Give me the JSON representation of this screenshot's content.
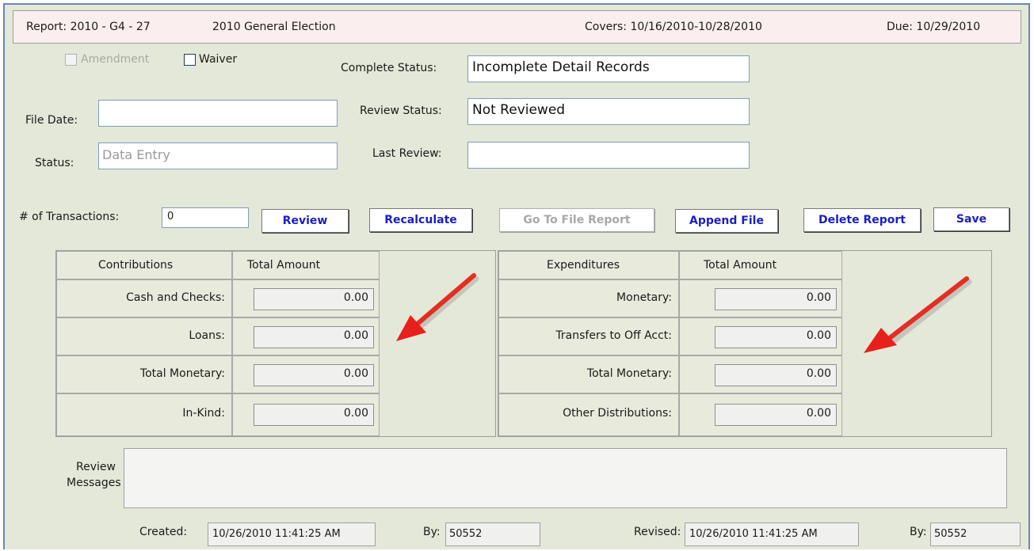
{
  "header": {
    "report": "Report: 2010 - G4 - 27",
    "election": "2010 General Election",
    "covers": "Covers:  10/16/2010-10/28/2010",
    "due": "Due:  10/29/2010"
  },
  "form": {
    "amendment_label": "Amendment",
    "waiver_label": "Waiver",
    "file_date_label": "File Date:",
    "file_date_value": "",
    "status_label": "Status:",
    "status_value": "Data Entry",
    "complete_status_label": "Complete Status:",
    "complete_status_value": "Incomplete Detail Records",
    "review_status_label": "Review Status:",
    "review_status_value": "Not Reviewed",
    "last_review_label": "Last Review:",
    "last_review_value": "",
    "transactions_label": "# of Transactions:",
    "transactions_value": "0"
  },
  "buttons": {
    "review": "Review",
    "recalculate": "Recalculate",
    "go_to_file": "Go To File Report",
    "append": "Append File",
    "delete": "Delete Report",
    "save": "Save"
  },
  "contributions": {
    "header": "Contributions",
    "amount_header": "Total Amount",
    "rows": [
      {
        "label": "Cash and Checks:",
        "value": "0.00"
      },
      {
        "label": "Loans:",
        "value": "0.00"
      },
      {
        "label": "Total Monetary:",
        "value": "0.00"
      },
      {
        "label": "In-Kind:",
        "value": "0.00"
      }
    ]
  },
  "expenditures": {
    "header": "Expenditures",
    "amount_header": "Total Amount",
    "rows": [
      {
        "label": "Monetary:",
        "value": "0.00"
      },
      {
        "label": "Transfers to Off Acct:",
        "value": "0.00"
      },
      {
        "label": "Total Monetary:",
        "value": "0.00"
      },
      {
        "label": "Other Distributions:",
        "value": "0.00"
      }
    ]
  },
  "review": {
    "label_line1": "Review",
    "label_line2": "Messages",
    "value": ""
  },
  "footer": {
    "created_label": "Created:",
    "created_value": "10/26/2010 11:41:25 AM",
    "created_by_label": "By:",
    "created_by_value": "50552",
    "revised_label": "Revised:",
    "revised_value": "10/26/2010 11:41:25 AM",
    "revised_by_label": "By:",
    "revised_by_value": "50552"
  },
  "annotations": {
    "arrow_color": "#e8201c",
    "arrow_icon": "red-arrow-icon"
  }
}
